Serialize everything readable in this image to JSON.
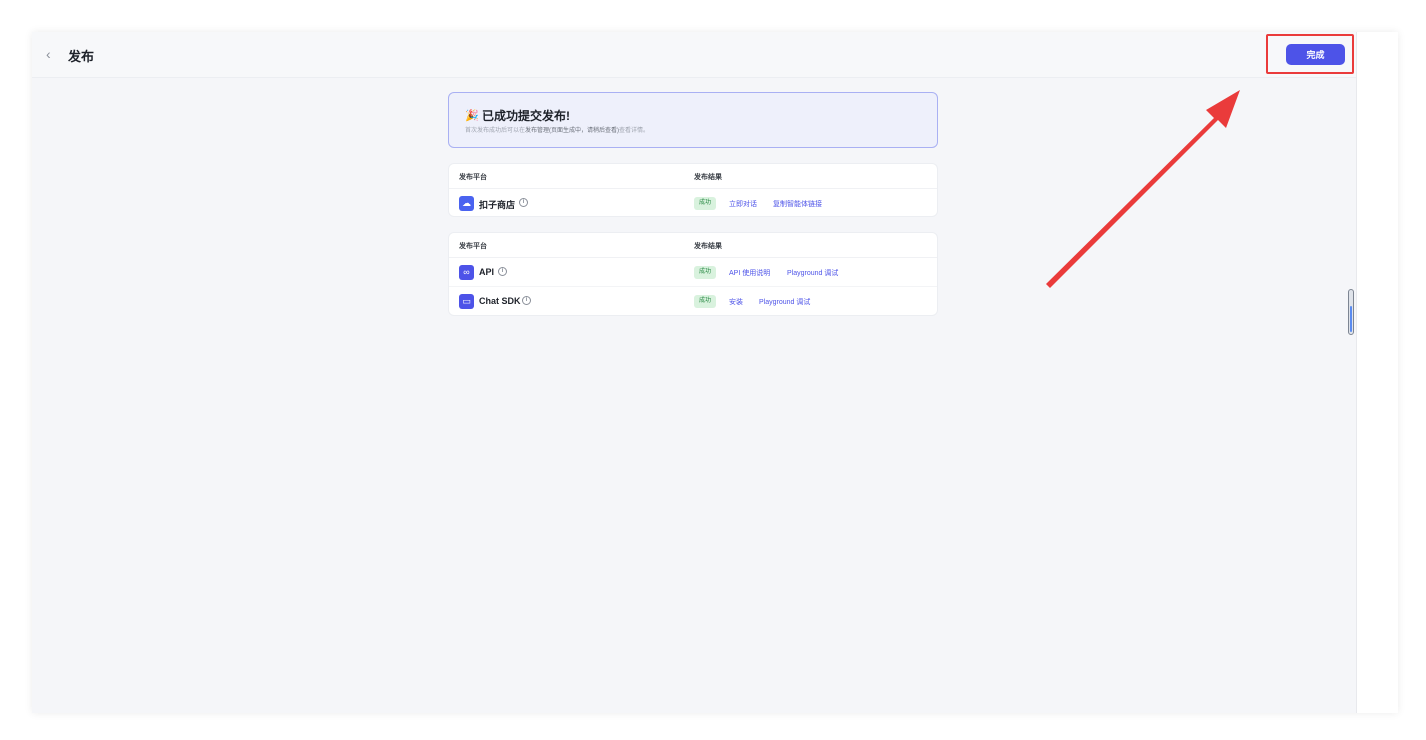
{
  "header": {
    "back_icon": "chevron-left-icon",
    "title": "发布",
    "done_label": "完成"
  },
  "banner": {
    "emoji": "🎉",
    "title": "已成功提交发布!",
    "desc_prefix": "首次发布成功后可以在",
    "desc_bold": "发布管理(页面生成中，请稍后查看)",
    "desc_suffix": "查看详情。"
  },
  "table1": {
    "col_platform": "发布平台",
    "col_result": "发布结果",
    "rows": [
      {
        "icon": "store-icon",
        "name": "扣子商店",
        "status": "成功",
        "links": [
          "立即对话",
          "复制智能体链接"
        ]
      }
    ]
  },
  "table2": {
    "col_platform": "发布平台",
    "col_result": "发布结果",
    "rows": [
      {
        "icon": "link-icon",
        "name": "API",
        "status": "成功",
        "links": [
          "API 使用说明",
          "Playground 调试"
        ]
      },
      {
        "icon": "chat-window-icon",
        "name": "Chat SDK",
        "status": "成功",
        "links": [
          "安装",
          "Playground 调试"
        ]
      }
    ]
  },
  "colors": {
    "accent": "#4d53e8",
    "success_bg": "#d9f2de",
    "success_text": "#2a8a45",
    "annotation": "#ea3b3b"
  }
}
